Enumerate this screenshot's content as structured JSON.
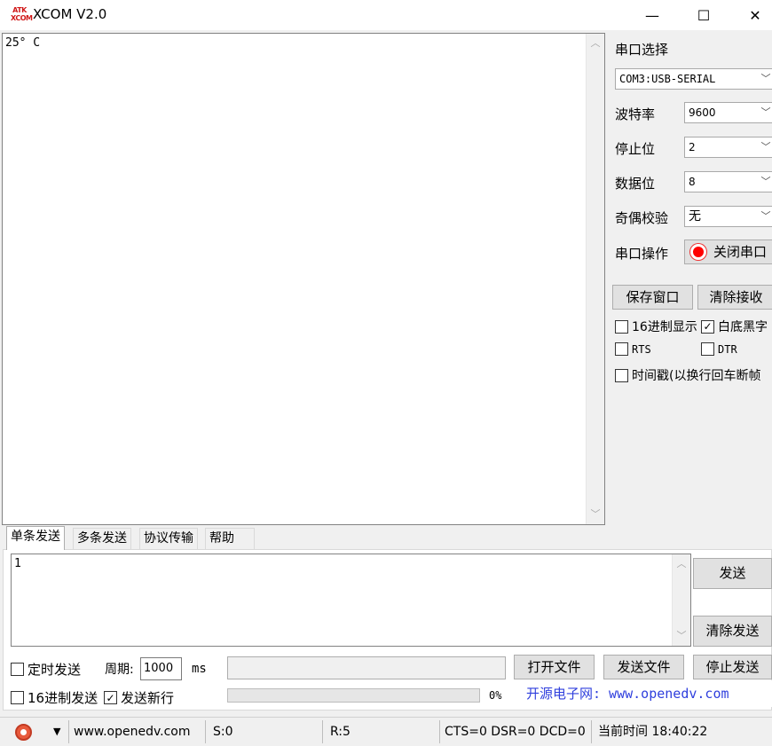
{
  "window": {
    "icon_text": [
      "ATK",
      "XCOM"
    ],
    "title": "XCOM V2.0",
    "controls": {
      "minimize": "—",
      "maximize": "☐",
      "close": "✕"
    }
  },
  "receive": {
    "text": "25° C"
  },
  "right_panel": {
    "port_label": "串口选择",
    "port_value": "COM3:USB-SERIAL",
    "baud_label": "波特率",
    "baud_value": "9600",
    "stopbits_label": "停止位",
    "stopbits_value": "2",
    "databits_label": "数据位",
    "databits_value": "8",
    "parity_label": "奇偶校验",
    "parity_value": "无",
    "op_label": "串口操作",
    "op_button": "关闭串口",
    "save_window": "保存窗口",
    "clear_receive": "清除接收",
    "hex_display": "16进制显示",
    "white_black": "白底黑字",
    "rts": "RTS",
    "dtr": "DTR",
    "timestamp": "时间戳(以换行回车断帧"
  },
  "tabs": [
    "单条发送",
    "多条发送",
    "协议传输",
    "帮助"
  ],
  "send": {
    "text": "1",
    "send_button": "发送",
    "clear_send_button": "清除发送",
    "timed_send": "定时发送",
    "period_label": "周期:",
    "period_value": "1000",
    "period_unit": "ms",
    "open_file": "打开文件",
    "send_file": "发送文件",
    "stop_send": "停止发送",
    "hex_send": "16进制发送",
    "send_newline": "发送新行",
    "progress_percent": 0,
    "progress_text": "0%",
    "promo": "开源电子网: www.openedv.com"
  },
  "checkbox_states": {
    "hex_display": false,
    "white_black": true,
    "rts": false,
    "dtr": false,
    "timestamp": false,
    "timed_send": false,
    "hex_send": false,
    "send_newline": true
  },
  "status": {
    "dropdown": "▼",
    "url": "www.openedv.com",
    "sent": "S:0",
    "received": "R:5",
    "signals": "CTS=0 DSR=0 DCD=0",
    "time": "当前时间 18:40:22"
  },
  "colors": {
    "accent_red": "#ff0000",
    "promo_blue": "#2f3fdd"
  }
}
